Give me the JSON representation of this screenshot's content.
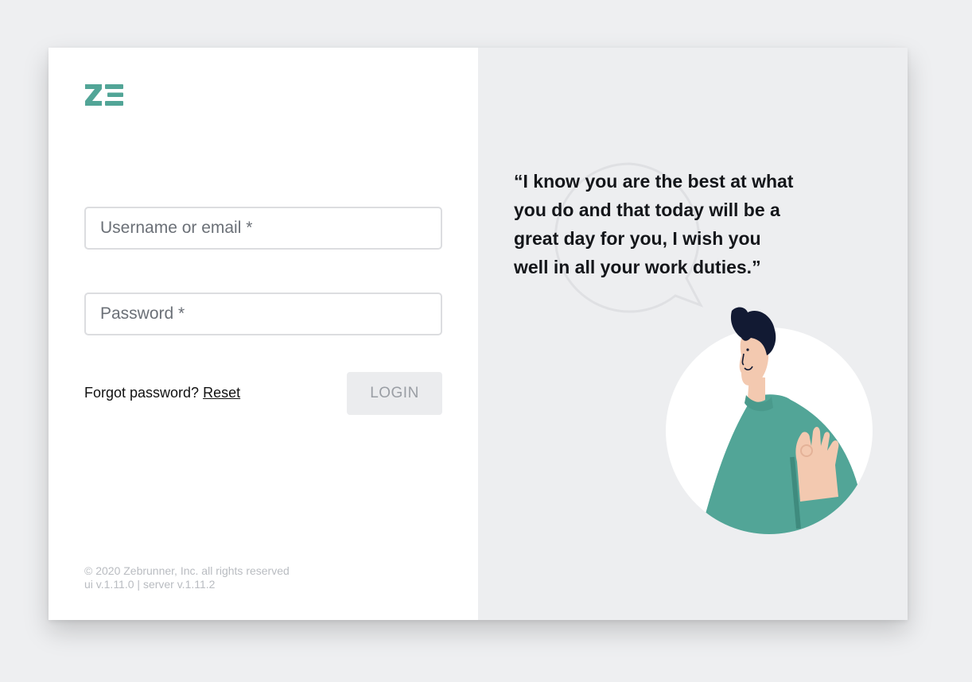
{
  "brand": {
    "logo_alt": "Zebrunner logo",
    "accent_color": "#52a597"
  },
  "login_form": {
    "username_placeholder": "Username or email *",
    "password_placeholder": "Password *",
    "forgot_text": "Forgot password?",
    "reset_link": "Reset",
    "login_button": "LOGIN"
  },
  "footer": {
    "copyright": "© 2020 Zebrunner, Inc. all rights reserved",
    "version": "ui v.1.11.0 | server v.1.11.2"
  },
  "promo": {
    "quote": "“I know you are the best at what you do and that today will be a great day for you, I wish you well in all your work duties.”"
  },
  "colors": {
    "page_bg": "#eeeff1",
    "right_panel_bg": "#edeef0",
    "shirt": "#52a597",
    "hair": "#121a33",
    "skin": "#f3c9b0"
  }
}
